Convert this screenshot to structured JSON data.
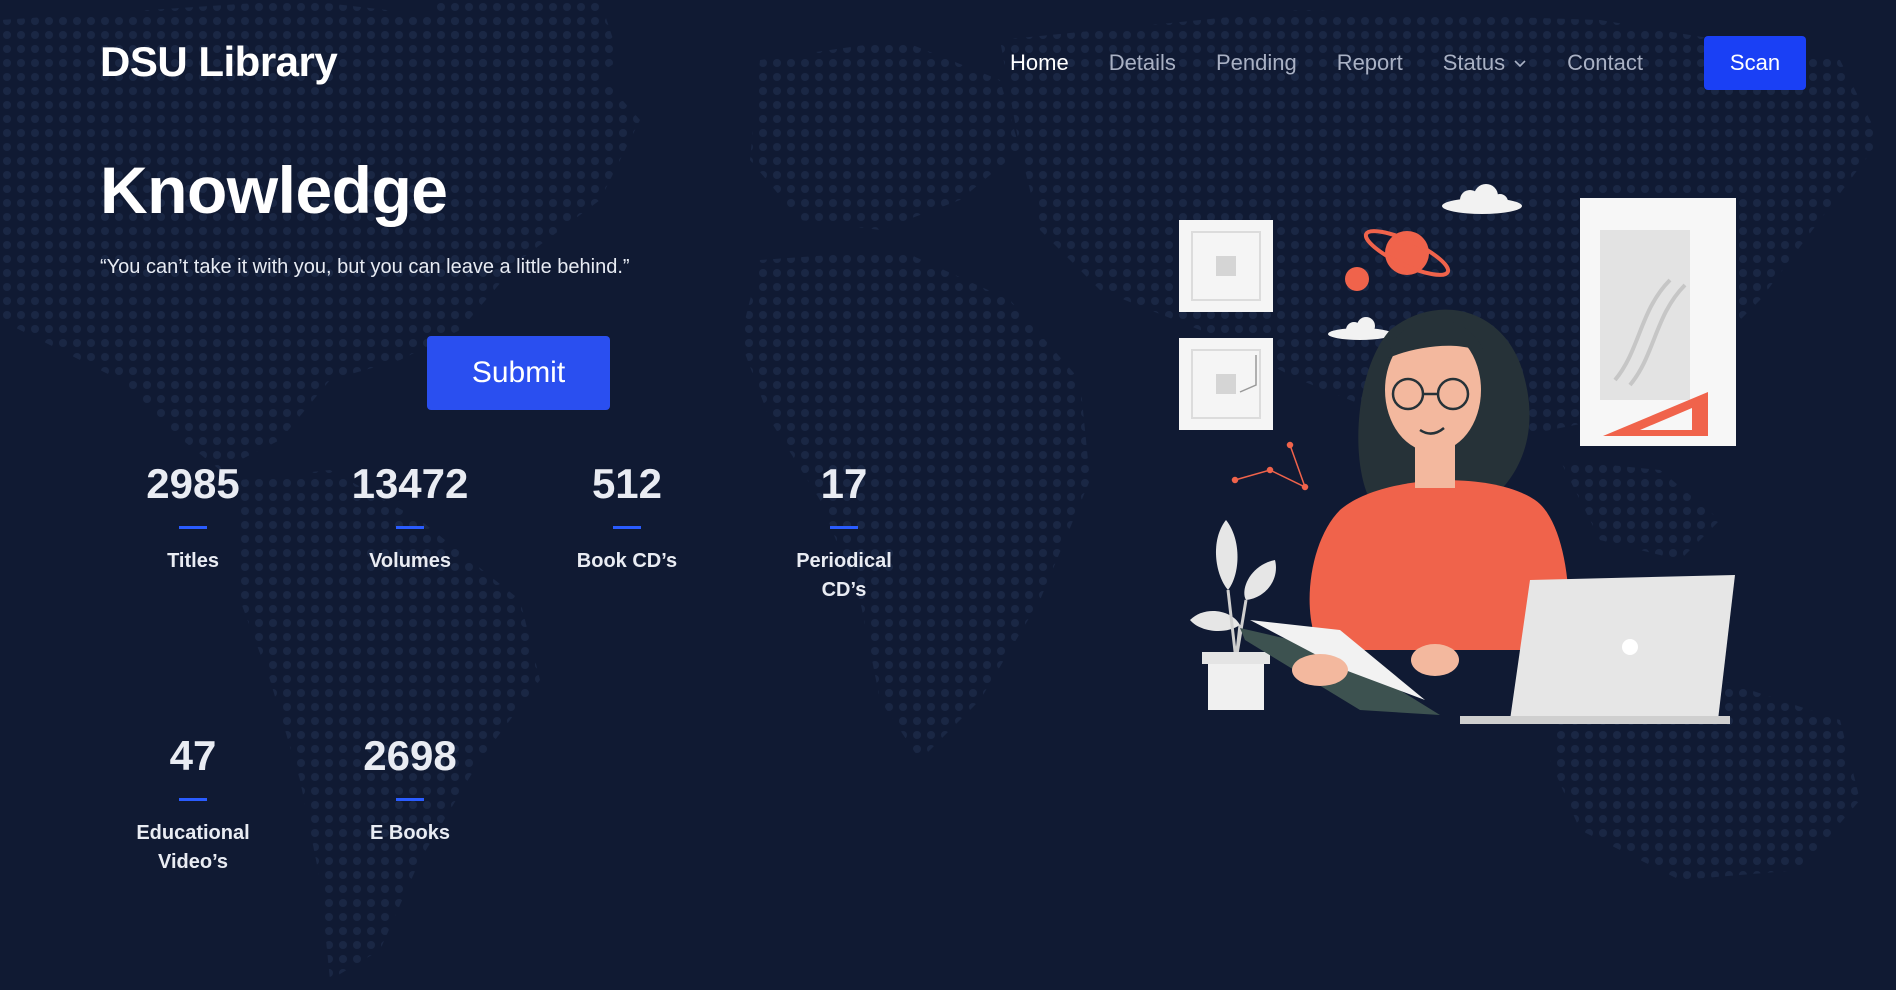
{
  "brand": "DSU Library",
  "nav": {
    "home": "Home",
    "details": "Details",
    "pending": "Pending",
    "report": "Report",
    "status": "Status",
    "contact": "Contact",
    "scan": "Scan"
  },
  "hero": {
    "title": "Knowledge",
    "quote": "“You can’t take it with you, but you can leave a little behind.”",
    "submit": "Submit"
  },
  "stats": [
    {
      "value": "2985",
      "label": "Titles"
    },
    {
      "value": "13472",
      "label": "Volumes"
    },
    {
      "value": "512",
      "label": "Book CD’s"
    },
    {
      "value": "17",
      "label": "Periodical CD’s"
    },
    {
      "value": "47",
      "label": "Educational Video’s"
    },
    {
      "value": "2698",
      "label": "E Books"
    }
  ],
  "colors": {
    "background": "#101a33",
    "accent": "#1a40f5",
    "nav_inactive": "#a9b1c4"
  },
  "icons": {
    "status_dropdown": "chevron-down-icon"
  }
}
